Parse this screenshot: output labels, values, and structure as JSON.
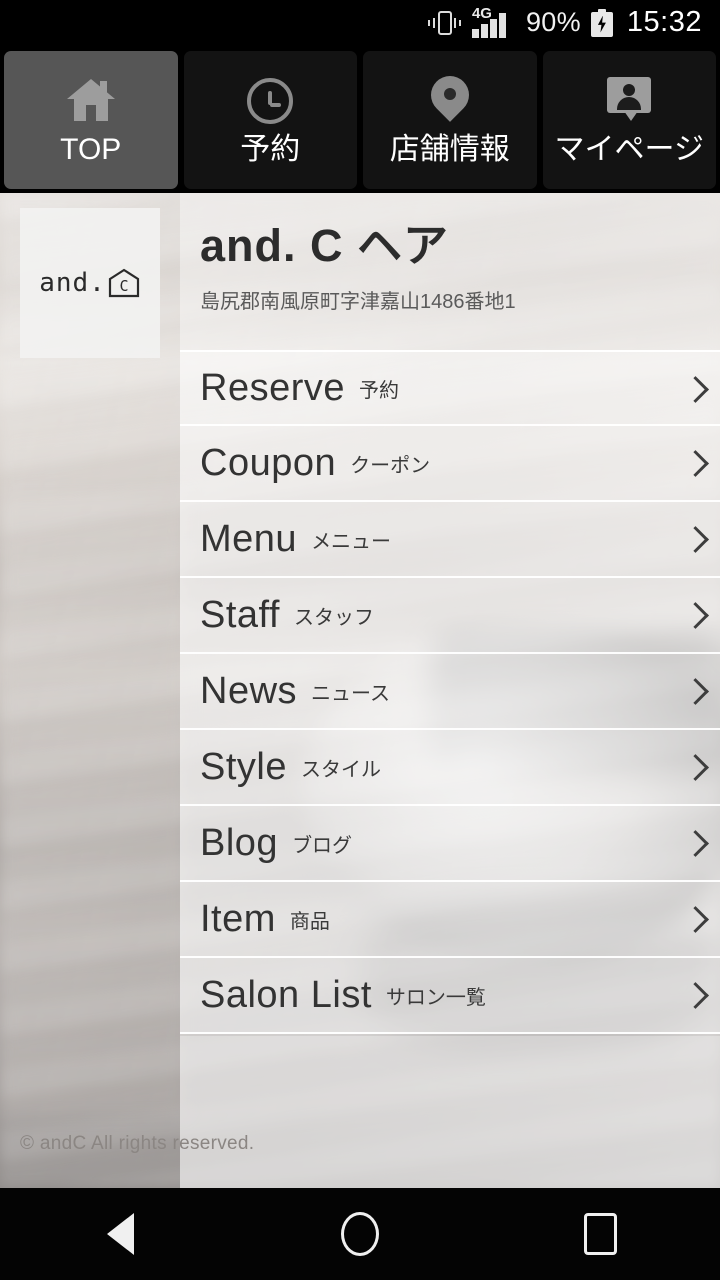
{
  "status_bar": {
    "vibrate_icon": "vibrate-icon",
    "network_label": "4G",
    "signal_icon": "signal-bars-icon",
    "battery_percent": "90%",
    "battery_icon": "battery-charging-icon",
    "clock": "15:32"
  },
  "tabs": [
    {
      "label": "TOP",
      "icon": "home-icon",
      "active": true
    },
    {
      "label": "予約",
      "icon": "clock-icon",
      "active": false
    },
    {
      "label": "店舗情報",
      "icon": "map-pin-icon",
      "active": false
    },
    {
      "label": "マイページ",
      "icon": "person-badge-icon",
      "active": false
    }
  ],
  "logo": {
    "text": "and.",
    "mark": "house-c-icon",
    "mark_letter": "C"
  },
  "salon": {
    "name": "and. C ヘア",
    "address": "島尻郡南風原町字津嘉山1486番地1"
  },
  "menu": [
    {
      "en": "Reserve",
      "ja": "予約",
      "chevron": "chevron-right-icon"
    },
    {
      "en": "Coupon",
      "ja": "クーポン",
      "chevron": "chevron-right-icon"
    },
    {
      "en": "Menu",
      "ja": "メニュー",
      "chevron": "chevron-right-icon"
    },
    {
      "en": "Staff",
      "ja": "スタッフ",
      "chevron": "chevron-right-icon"
    },
    {
      "en": "News",
      "ja": "ニュース",
      "chevron": "chevron-right-icon"
    },
    {
      "en": "Style",
      "ja": "スタイル",
      "chevron": "chevron-right-icon"
    },
    {
      "en": "Blog",
      "ja": "ブログ",
      "chevron": "chevron-right-icon"
    },
    {
      "en": "Item",
      "ja": "商品",
      "chevron": "chevron-right-icon"
    },
    {
      "en": "Salon List",
      "ja": "サロン一覧",
      "chevron": "chevron-right-icon"
    }
  ],
  "footer": {
    "copyright": "© andC All rights reserved."
  },
  "nav_bar": {
    "back": "back-triangle-icon",
    "home": "home-circle-icon",
    "recents": "recents-square-icon"
  },
  "colors": {
    "status_bar_bg": "#000000",
    "tab_bg": "#131313",
    "tab_active_bg": "#565656",
    "panel_overlay": "rgba(255,255,255,0.40)",
    "title_text": "#2c2c2c",
    "menu_en_text": "#333333",
    "nav_bar_bg": "#040404"
  }
}
